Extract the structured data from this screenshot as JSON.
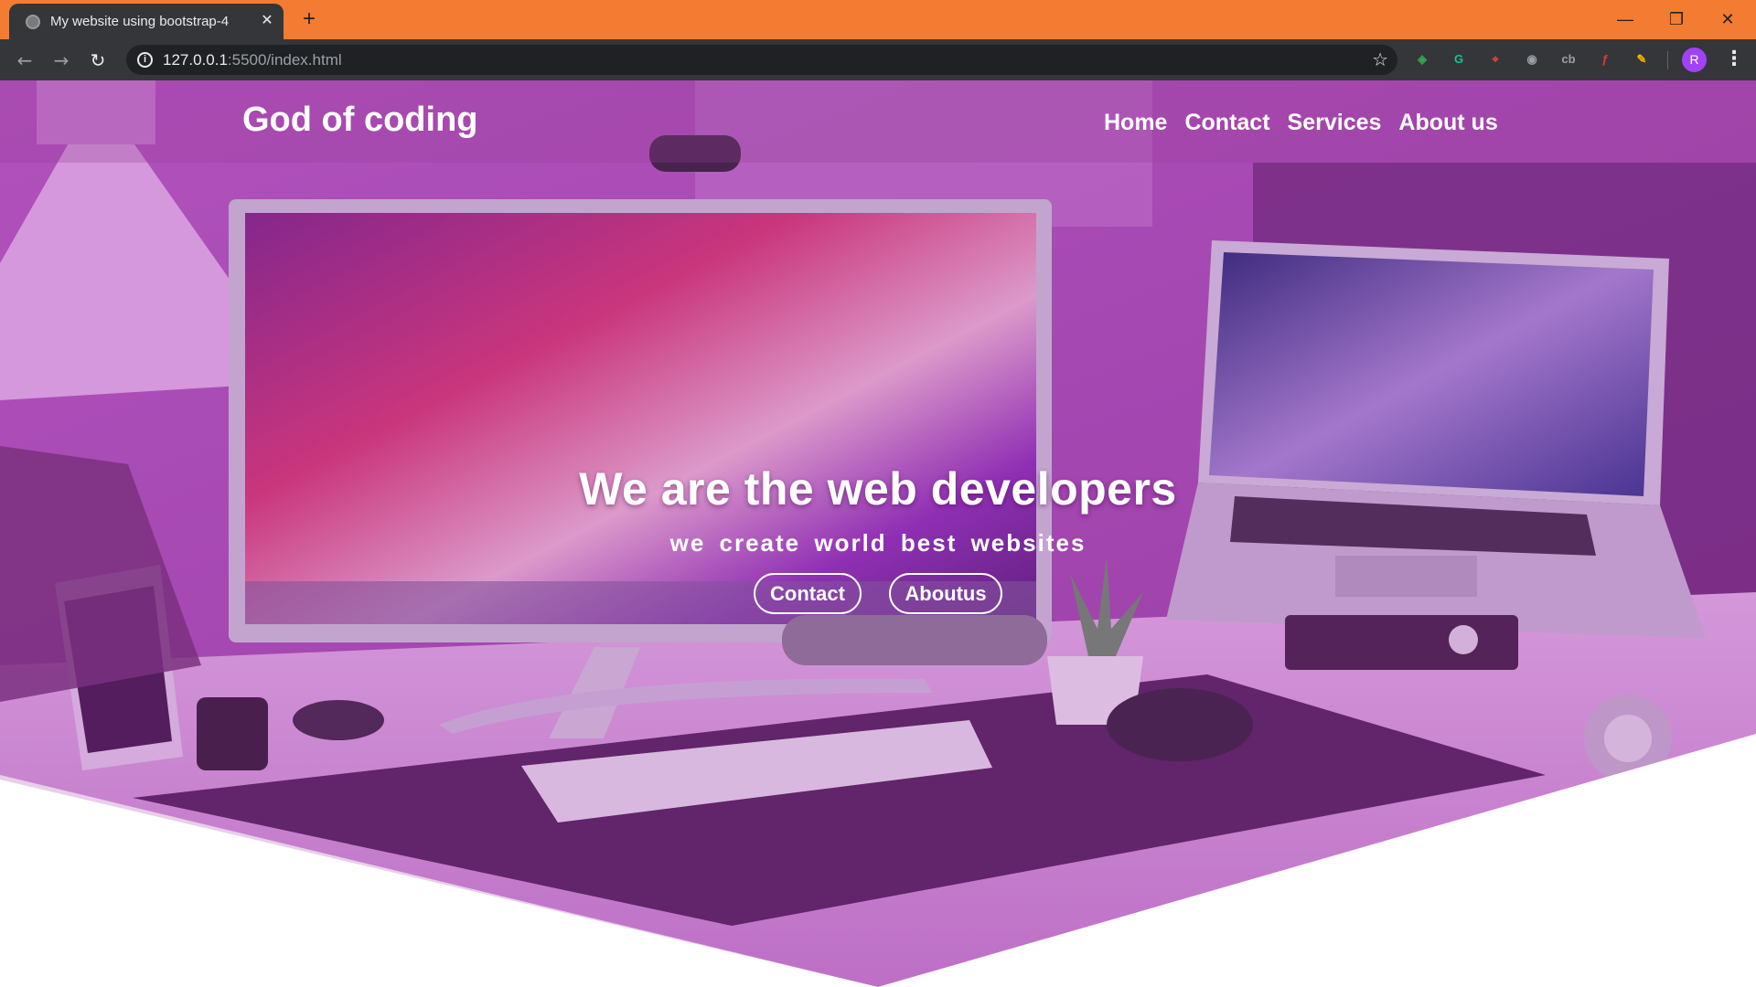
{
  "browser": {
    "tab_title": "My website using bootstrap-4",
    "tab_close": "✕",
    "new_tab": "+",
    "window_controls": {
      "minimize": "—",
      "restore": "❐",
      "close": "✕"
    },
    "nav": {
      "back": "←",
      "forward": "→",
      "reload": "↻"
    },
    "url_host": "127.0.0.1",
    "url_rest": ":5500/index.html",
    "info_icon": "i",
    "star": "☆",
    "avatar_letter": "R",
    "menu": "⋮",
    "extensions": [
      {
        "name": "color-extension-icon",
        "glyph": "◈",
        "color": "#34a853"
      },
      {
        "name": "grammarly-icon",
        "glyph": "G",
        "color": "#15c39a"
      },
      {
        "name": "pin-extension-icon",
        "glyph": "⌖",
        "color": "#ea4335"
      },
      {
        "name": "camera-extension-icon",
        "glyph": "◉",
        "color": "#9aa0a6"
      },
      {
        "name": "cb-extension-icon",
        "glyph": "cb",
        "color": "#9aa0a6"
      },
      {
        "name": "font-extension-icon",
        "glyph": "ƒ",
        "color": "#e53935"
      },
      {
        "name": "pencil-extension-icon",
        "glyph": "✎",
        "color": "#f4b400"
      }
    ]
  },
  "site": {
    "brand": "God of coding",
    "nav_links": [
      "Home",
      "Contact",
      "Services",
      "About us"
    ],
    "hero_title": "We are the web developers",
    "hero_subtitle": "we create world best websites",
    "buttons": [
      "Contact",
      "Aboutus"
    ]
  },
  "colors": {
    "titlebar": "#f37c32",
    "overlay": "#a040a8"
  }
}
